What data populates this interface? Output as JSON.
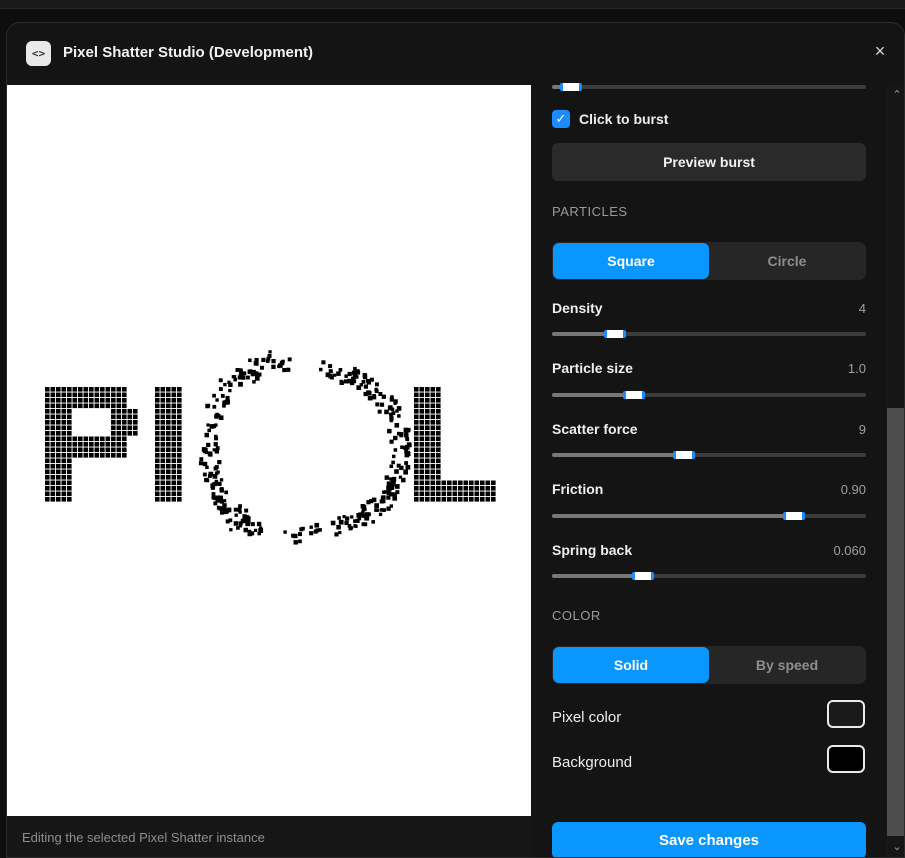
{
  "window": {
    "title": "Pixel Shatter Studio (Development)",
    "icon": "code-icon",
    "close_glyph": "×"
  },
  "canvas": {
    "background": "#ffffff",
    "pixel_color": "#000000"
  },
  "status": {
    "text": "Editing the selected Pixel Shatter instance"
  },
  "controls": {
    "top_slider_value": 0.07,
    "click_to_burst": {
      "label": "Click to burst",
      "checked": true
    },
    "preview_button": "Preview burst",
    "particles": {
      "section": "PARTICLES",
      "options": [
        "Square",
        "Circle"
      ],
      "selected": "Square"
    },
    "sliders": [
      {
        "label": "Density",
        "value": "4",
        "level": 0.21
      },
      {
        "label": "Particle size",
        "value": "1.0",
        "level": 0.27
      },
      {
        "label": "Scatter force",
        "value": "9",
        "level": 0.43
      },
      {
        "label": "Friction",
        "value": "0.90",
        "level": 0.78
      },
      {
        "label": "Spring back",
        "value": "0.060",
        "level": 0.3
      }
    ],
    "color": {
      "section": "COLOR",
      "options": [
        "Solid",
        "By speed"
      ],
      "selected": "Solid",
      "pixel_color_label": "Pixel color",
      "pixel_color": "#1a1a1a",
      "background_label": "Background",
      "background": "#000000"
    },
    "save_button": "Save changes"
  },
  "theme": {
    "accent": "#0a96ff"
  }
}
